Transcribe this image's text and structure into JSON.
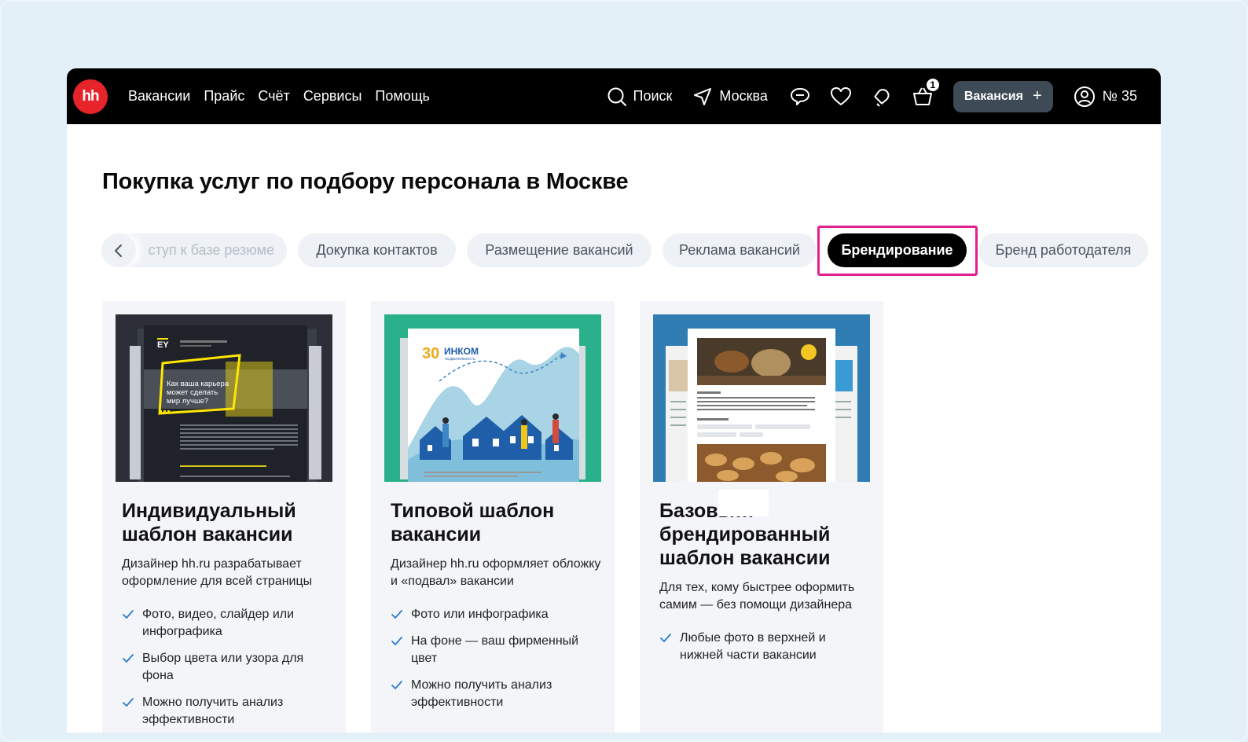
{
  "header": {
    "logo": "hh",
    "nav": [
      "Вакансии",
      "Прайс",
      "Счёт",
      "Сервисы",
      "Помощь"
    ],
    "search_label": "Поиск",
    "city_label": "Москва",
    "cart_count": "1",
    "vacancy_button": "Вакансия",
    "vacancy_button_plus": "+",
    "account_label": "№ 35"
  },
  "page": {
    "title": "Покупка услуг по подбору персонала в Москве"
  },
  "chips": [
    {
      "label": "ступ к базе резюме",
      "active": false
    },
    {
      "label": "Докупка контактов",
      "active": false
    },
    {
      "label": "Размещение вакансий",
      "active": false
    },
    {
      "label": "Реклама вакансий",
      "active": false
    },
    {
      "label": "Брендирование",
      "active": true
    },
    {
      "label": "Бренд работодателя",
      "active": false
    }
  ],
  "cards": [
    {
      "title": "Индивидуальный шаблон вакансии",
      "desc": "Дизайнер hh.ru разрабатывает оформление для всей страницы",
      "features": [
        "Фото, видео, слайдер или инфографика",
        "Выбор цвета или узора для фона",
        "Можно получить анализ эффективности"
      ],
      "thumb_text": "Как ваша карьера может сделать мир лучше?",
      "thumb_logo": "EY"
    },
    {
      "title": "Типовой шаблон вакансии",
      "desc": "Дизайнер hh.ru оформляет обложку и «подвал» вакансии",
      "features": [
        "Фото или инфографика",
        "На фоне — ваш фирменный цвет",
        "Можно получить анализ эффективности"
      ],
      "thumb_logo": "ИНКОМ",
      "thumb_number": "30",
      "thumb_sub": "НЕДВИЖИМОСТЬ"
    },
    {
      "title": "Базовы… брендированный шаблон вакансии",
      "desc": "Для тех, кому быстрее оформить самим — без помощи дизайнера",
      "features": [
        "Любые фото в верхней и нижней части вакансии"
      ]
    }
  ],
  "colors": {
    "accent_red": "#e8242b",
    "highlight": "#e0208f",
    "check": "#2a7dd1"
  }
}
